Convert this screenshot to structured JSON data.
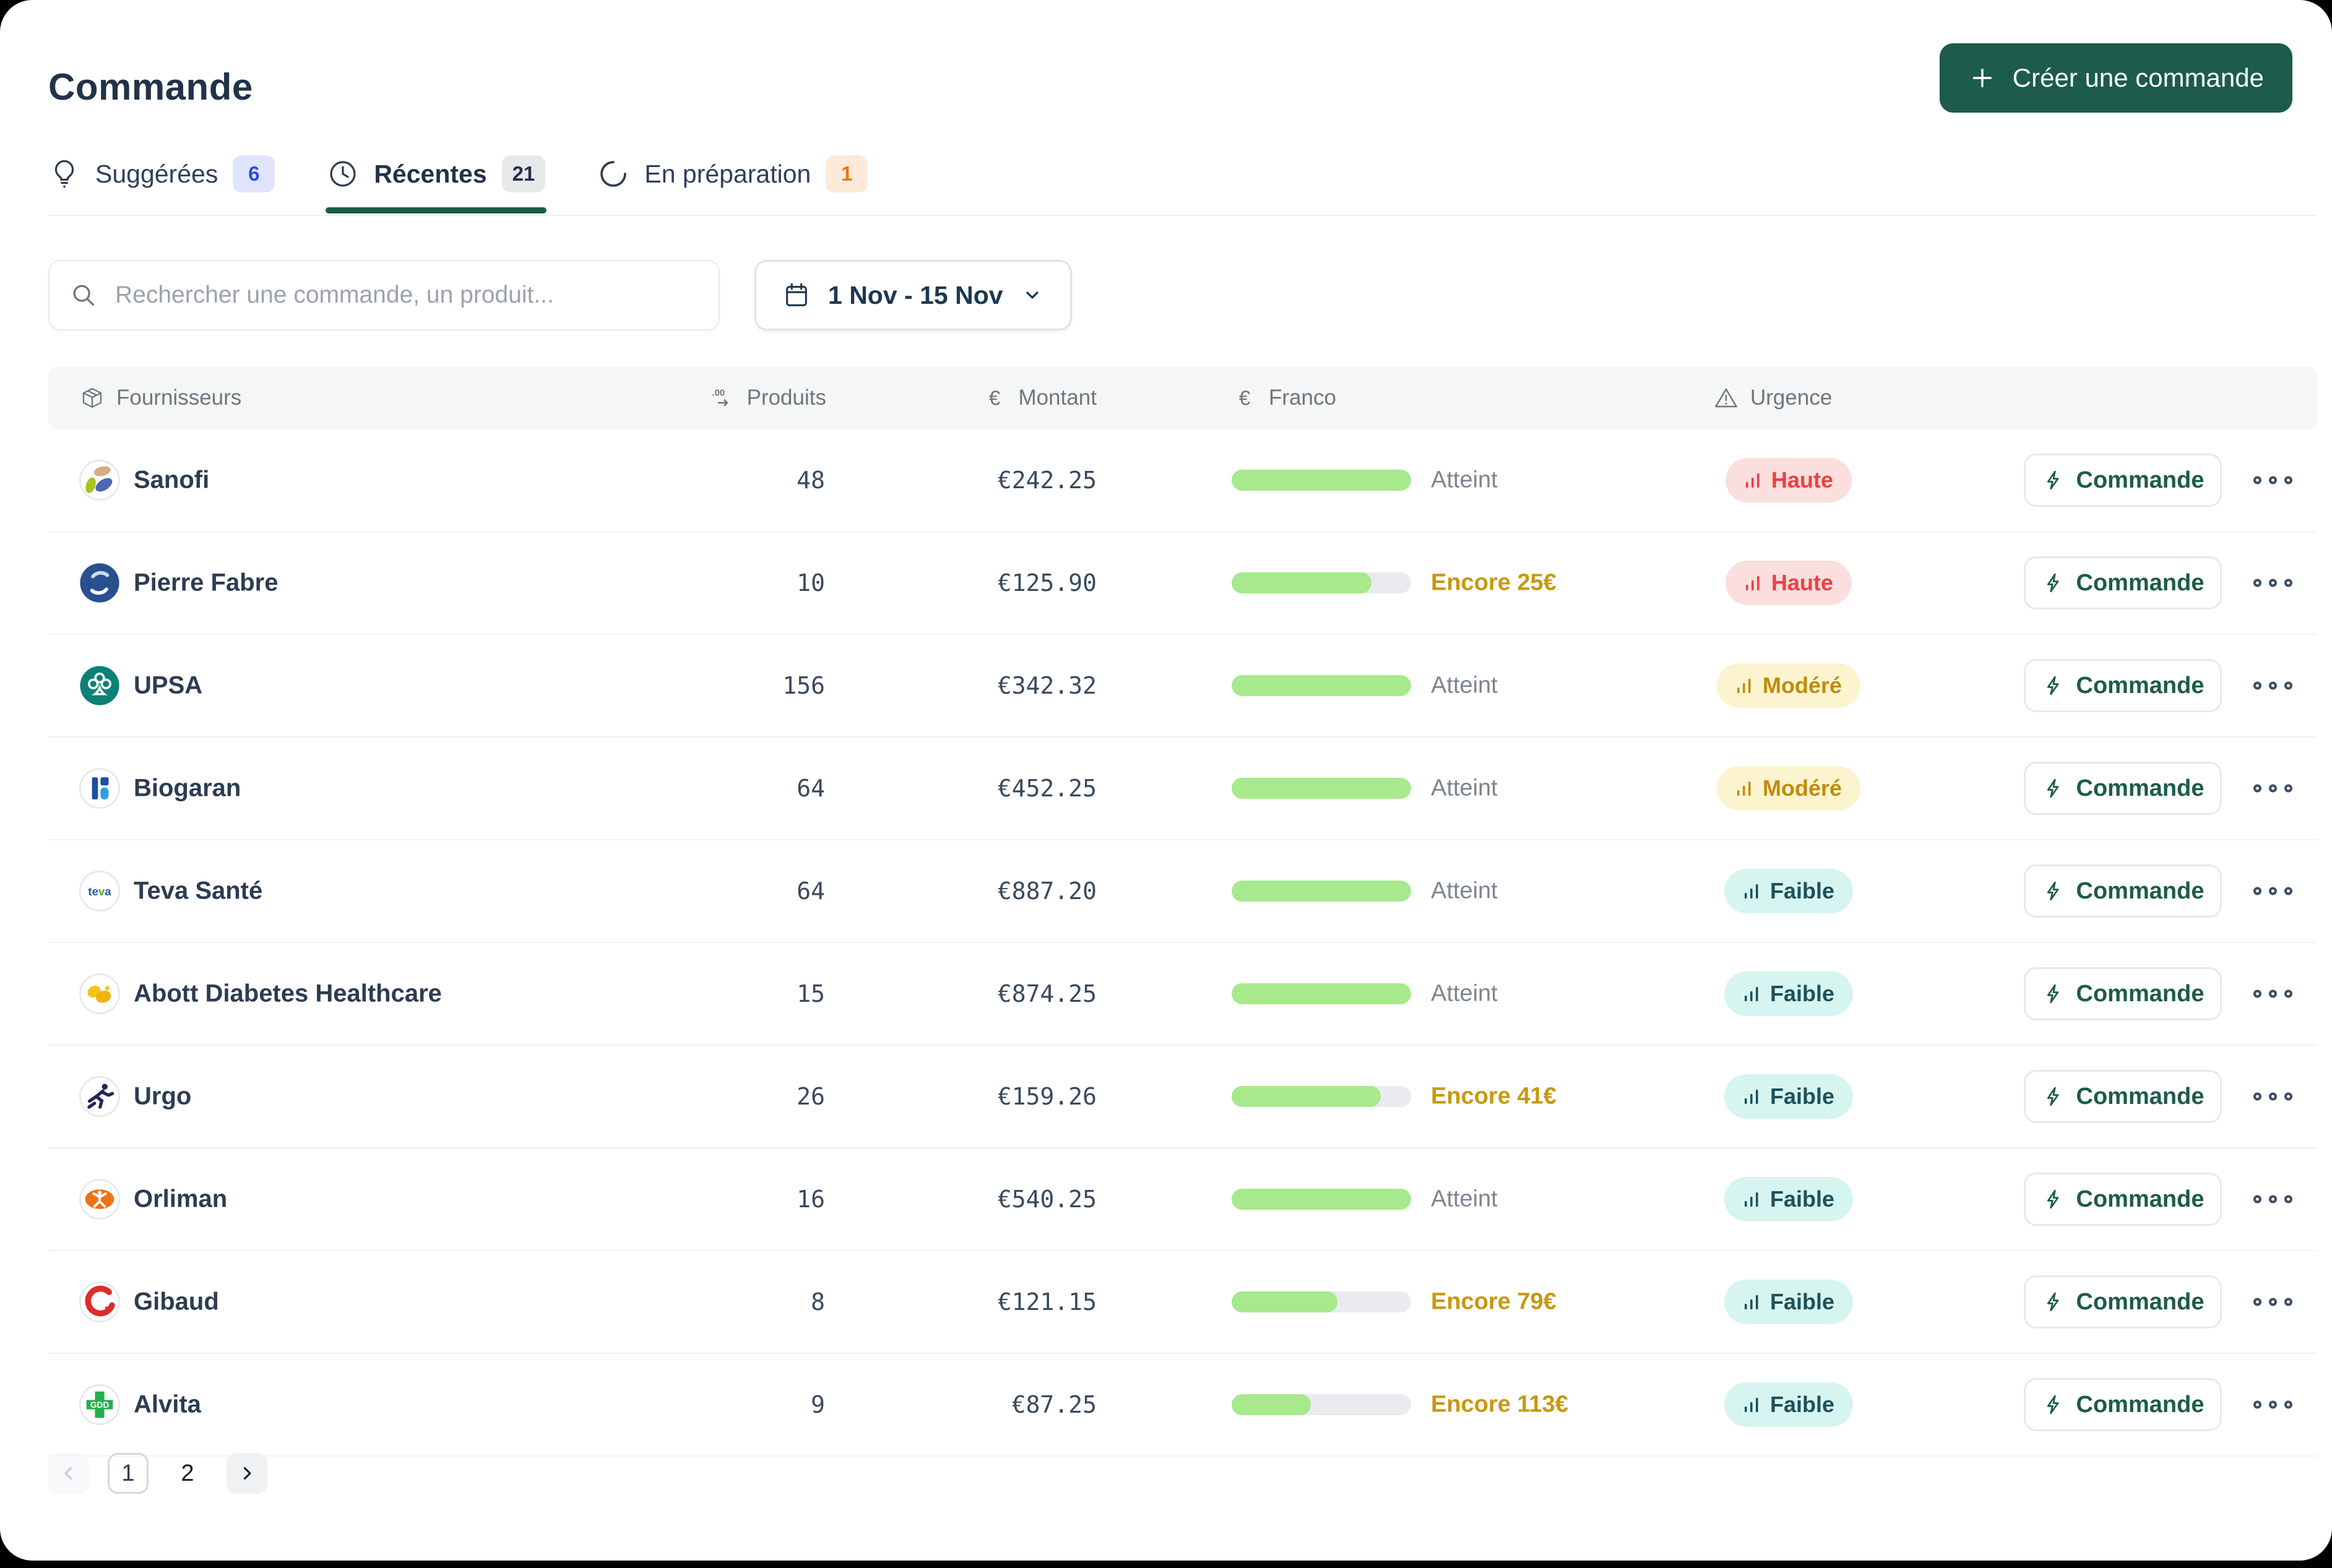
{
  "page": {
    "title": "Commande"
  },
  "create_button": {
    "label": "Créer une commande",
    "color": "#1d5b4a"
  },
  "tabs": [
    {
      "label": "Suggérées",
      "count": "6",
      "icon": "lightbulb-icon",
      "active": false
    },
    {
      "label": "Récentes",
      "count": "21",
      "icon": "clock-icon",
      "active": true
    },
    {
      "label": "En préparation",
      "count": "1",
      "icon": "spinner-icon",
      "active": false
    }
  ],
  "search": {
    "placeholder": "Rechercher une commande, un produit..."
  },
  "date_filter": {
    "label": "1 Nov - 15 Nov"
  },
  "table": {
    "columns": [
      "Fournisseurs",
      "Produits",
      "Montant",
      "Franco",
      "Urgence"
    ],
    "action_label": "Commande",
    "franco_colors": {
      "fill": "#a7e98c",
      "track": "#e9ebee"
    },
    "urgency_colors": {
      "high": "#ee3f3f",
      "medium": "#bf8d09",
      "low": "#1d515c"
    },
    "rows": [
      {
        "supplier": "Sanofi",
        "logo": "sanofi",
        "products": "48",
        "amount": "€242.25",
        "franco_pct": 100,
        "franco_label": "Atteint",
        "urgency": "Haute",
        "urgency_level": "high"
      },
      {
        "supplier": "Pierre Fabre",
        "logo": "pierre-fabre",
        "products": "10",
        "amount": "€125.90",
        "franco_pct": 78,
        "franco_label": "Encore 25€",
        "urgency": "Haute",
        "urgency_level": "high"
      },
      {
        "supplier": "UPSA",
        "logo": "upsa",
        "products": "156",
        "amount": "€342.32",
        "franco_pct": 100,
        "franco_label": "Atteint",
        "urgency": "Modéré",
        "urgency_level": "medium"
      },
      {
        "supplier": "Biogaran",
        "logo": "biogaran",
        "products": "64",
        "amount": "€452.25",
        "franco_pct": 100,
        "franco_label": "Atteint",
        "urgency": "Modéré",
        "urgency_level": "medium"
      },
      {
        "supplier": "Teva Santé",
        "logo": "teva",
        "products": "64",
        "amount": "€887.20",
        "franco_pct": 100,
        "franco_label": "Atteint",
        "urgency": "Faible",
        "urgency_level": "low"
      },
      {
        "supplier": "Abott Diabetes Healthcare",
        "logo": "abbott",
        "products": "15",
        "amount": "€874.25",
        "franco_pct": 100,
        "franco_label": "Atteint",
        "urgency": "Faible",
        "urgency_level": "low"
      },
      {
        "supplier": "Urgo",
        "logo": "urgo",
        "products": "26",
        "amount": "€159.26",
        "franco_pct": 83,
        "franco_label": "Encore 41€",
        "urgency": "Faible",
        "urgency_level": "low"
      },
      {
        "supplier": "Orliman",
        "logo": "orliman",
        "products": "16",
        "amount": "€540.25",
        "franco_pct": 100,
        "franco_label": "Atteint",
        "urgency": "Faible",
        "urgency_level": "low"
      },
      {
        "supplier": "Gibaud",
        "logo": "gibaud",
        "products": "8",
        "amount": "€121.15",
        "franco_pct": 59,
        "franco_label": "Encore 79€",
        "urgency": "Faible",
        "urgency_level": "low"
      },
      {
        "supplier": "Alvita",
        "logo": "alvita",
        "products": "9",
        "amount": "€87.25",
        "franco_pct": 44,
        "franco_label": "Encore 113€",
        "urgency": "Faible",
        "urgency_level": "low"
      }
    ]
  },
  "pagination": {
    "pages": [
      "1",
      "2"
    ],
    "current": "1"
  }
}
